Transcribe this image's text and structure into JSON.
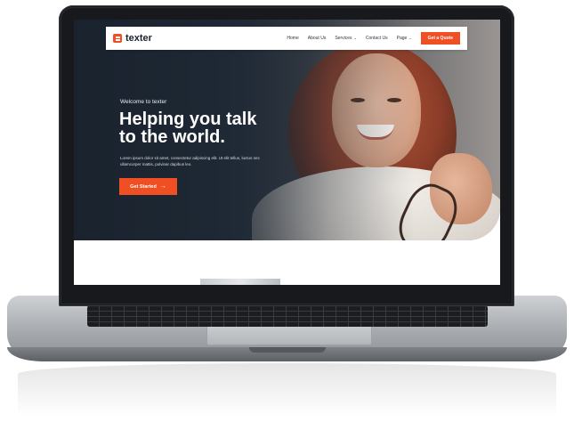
{
  "site": {
    "logo_text": "texter",
    "nav": {
      "items": [
        {
          "label": "Home",
          "has_dropdown": false
        },
        {
          "label": "About Us",
          "has_dropdown": false
        },
        {
          "label": "Services",
          "has_dropdown": true
        },
        {
          "label": "Contact Us",
          "has_dropdown": false
        },
        {
          "label": "Page",
          "has_dropdown": true
        }
      ],
      "cta_label": "Get a Quote"
    },
    "hero": {
      "eyebrow": "Welcome to texter",
      "headline_line1": "Helping you talk",
      "headline_line2": "to the world.",
      "lede": "Lorem ipsum dolor sit amet, consectetur adipiscing elit. Ut elit tellus, luctus nec ullamcorper mattis, pulvinar dapibus leo.",
      "button_label": "Get Started",
      "button_icon": "arrow-right-icon",
      "image": "smiling-woman-with-glasses-photo"
    },
    "colors": {
      "accent": "#f04e23",
      "hero_dark": "#1f2a37",
      "text_light": "#ffffff"
    }
  },
  "device": "laptop-mockup"
}
